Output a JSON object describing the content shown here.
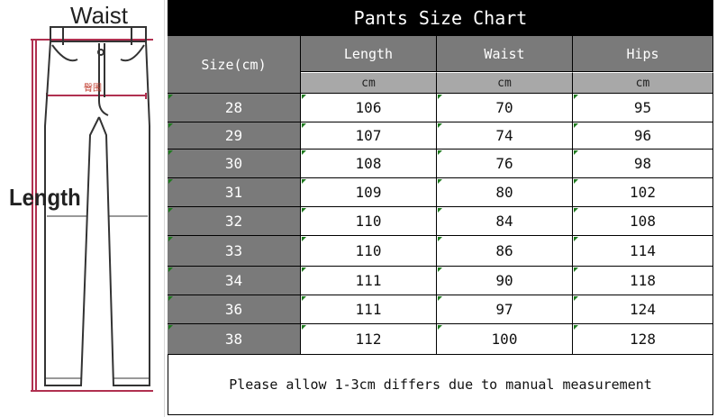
{
  "illustration": {
    "waist_label": "Waist",
    "length_label": "Length",
    "hip_label": "臀围"
  },
  "chart": {
    "title": "Pants Size Chart",
    "headers": {
      "size": "Size(cm)",
      "length": "Length",
      "waist": "Waist",
      "hips": "Hips"
    },
    "units": [
      "cm",
      "cm",
      "cm"
    ],
    "rows": [
      {
        "size": "28",
        "length": "106",
        "waist": "70",
        "hips": "95"
      },
      {
        "size": "29",
        "length": "107",
        "waist": "74",
        "hips": "96"
      },
      {
        "size": "30",
        "length": "108",
        "waist": "76",
        "hips": "98"
      },
      {
        "size": "31",
        "length": "109",
        "waist": "80",
        "hips": "102"
      },
      {
        "size": "32",
        "length": "110",
        "waist": "84",
        "hips": "108"
      },
      {
        "size": "33",
        "length": "110",
        "waist": "86",
        "hips": "114"
      },
      {
        "size": "34",
        "length": "111",
        "waist": "90",
        "hips": "118"
      },
      {
        "size": "36",
        "length": "111",
        "waist": "97",
        "hips": "124"
      },
      {
        "size": "38",
        "length": "112",
        "waist": "100",
        "hips": "128"
      }
    ],
    "note": "Please allow 1-3cm differs due to manual measurement"
  },
  "colors": {
    "header_dark": "#7a7a7a",
    "header_light": "#a8a8a8",
    "title_bg": "#000000",
    "measure_line": "#b03050",
    "cell_corner_mark": "#1f7a1f"
  }
}
